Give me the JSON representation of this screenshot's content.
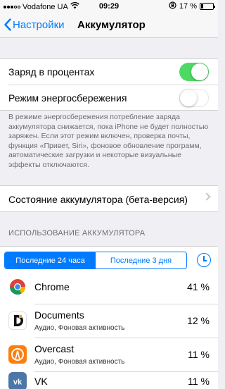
{
  "status_bar": {
    "carrier": "Vodafone UA",
    "time": "09:29",
    "battery_percent": "17 %",
    "battery_level": 0.17
  },
  "nav": {
    "back_label": "Настройки",
    "title": "Аккумулятор"
  },
  "settings": {
    "battery_percentage": {
      "label": "Заряд в процентах",
      "on": true
    },
    "low_power_mode": {
      "label": "Режим энергосбережения",
      "on": false
    },
    "footnote": "В режиме энергосбережения потребление заряда аккумулятора снижается, пока iPhone не будет полностью заряжен. Если этот режим включен, проверка почты, функция «Привет, Siri», фоновое обновление программ, автоматические загрузки и некоторые визуальные эффекты отключаются."
  },
  "battery_health": {
    "label": "Состояние аккумулятора (бета-версия)"
  },
  "usage": {
    "header": "ИСПОЛЬЗОВАНИЕ АККУМУЛЯТОРА",
    "segments": [
      "Последние 24 часа",
      "Последние 3 дня"
    ],
    "selected_segment": 0,
    "apps": [
      {
        "name": "Chrome",
        "subtitle": "",
        "percent": "41 %",
        "icon": "chrome-icon"
      },
      {
        "name": "Documents",
        "subtitle": "Аудио, Фоновая активность",
        "percent": "12 %",
        "icon": "documents-icon"
      },
      {
        "name": "Overcast",
        "subtitle": "Аудио, Фоновая активность",
        "percent": "11 %",
        "icon": "overcast-icon"
      },
      {
        "name": "VK",
        "subtitle": "",
        "percent": "11 %",
        "icon": "vk-icon"
      }
    ]
  },
  "colors": {
    "accent": "#007aff",
    "toggle_on": "#4cd964",
    "background": "#efeff4"
  }
}
